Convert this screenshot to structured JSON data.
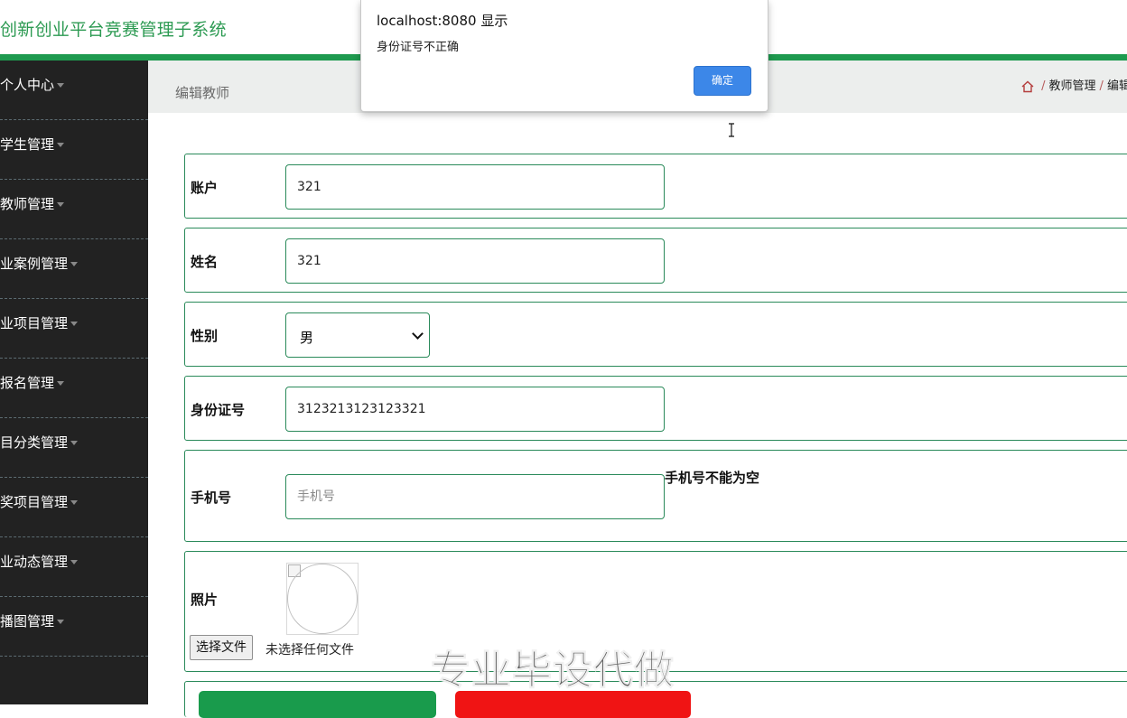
{
  "header": {
    "title": "创新创业平台竞赛管理子系统"
  },
  "sidebar": {
    "items": [
      {
        "label": "个人中心"
      },
      {
        "label": "学生管理"
      },
      {
        "label": "教师管理"
      },
      {
        "label": "业案例管理"
      },
      {
        "label": "业项目管理"
      },
      {
        "label": "报名管理"
      },
      {
        "label": "目分类管理"
      },
      {
        "label": "奖项目管理"
      },
      {
        "label": "业动态管理"
      },
      {
        "label": "播图管理"
      }
    ]
  },
  "page": {
    "heading": "编辑教师",
    "breadcrumb": [
      "教师管理",
      "编辑"
    ]
  },
  "form": {
    "account": {
      "label": "账户",
      "value": "321"
    },
    "name": {
      "label": "姓名",
      "value": "321"
    },
    "gender": {
      "label": "性别",
      "selected": "男"
    },
    "id_number": {
      "label": "身份证号",
      "value": "3123213123123321"
    },
    "phone": {
      "label": "手机号",
      "placeholder": "手机号",
      "error": "手机号不能为空"
    },
    "photo": {
      "label": "照片",
      "file_button": "选择文件",
      "file_status": "未选择任何文件"
    }
  },
  "dialog": {
    "origin": "localhost:8080 显示",
    "message": "身份证号不正确",
    "ok_label": "确定"
  },
  "watermark": "专业毕设代做",
  "colors": {
    "brand_green": "#1e9a4f",
    "sidebar_bg": "#222222",
    "danger_red": "#f01414",
    "dialog_button": "#3c87e8"
  }
}
